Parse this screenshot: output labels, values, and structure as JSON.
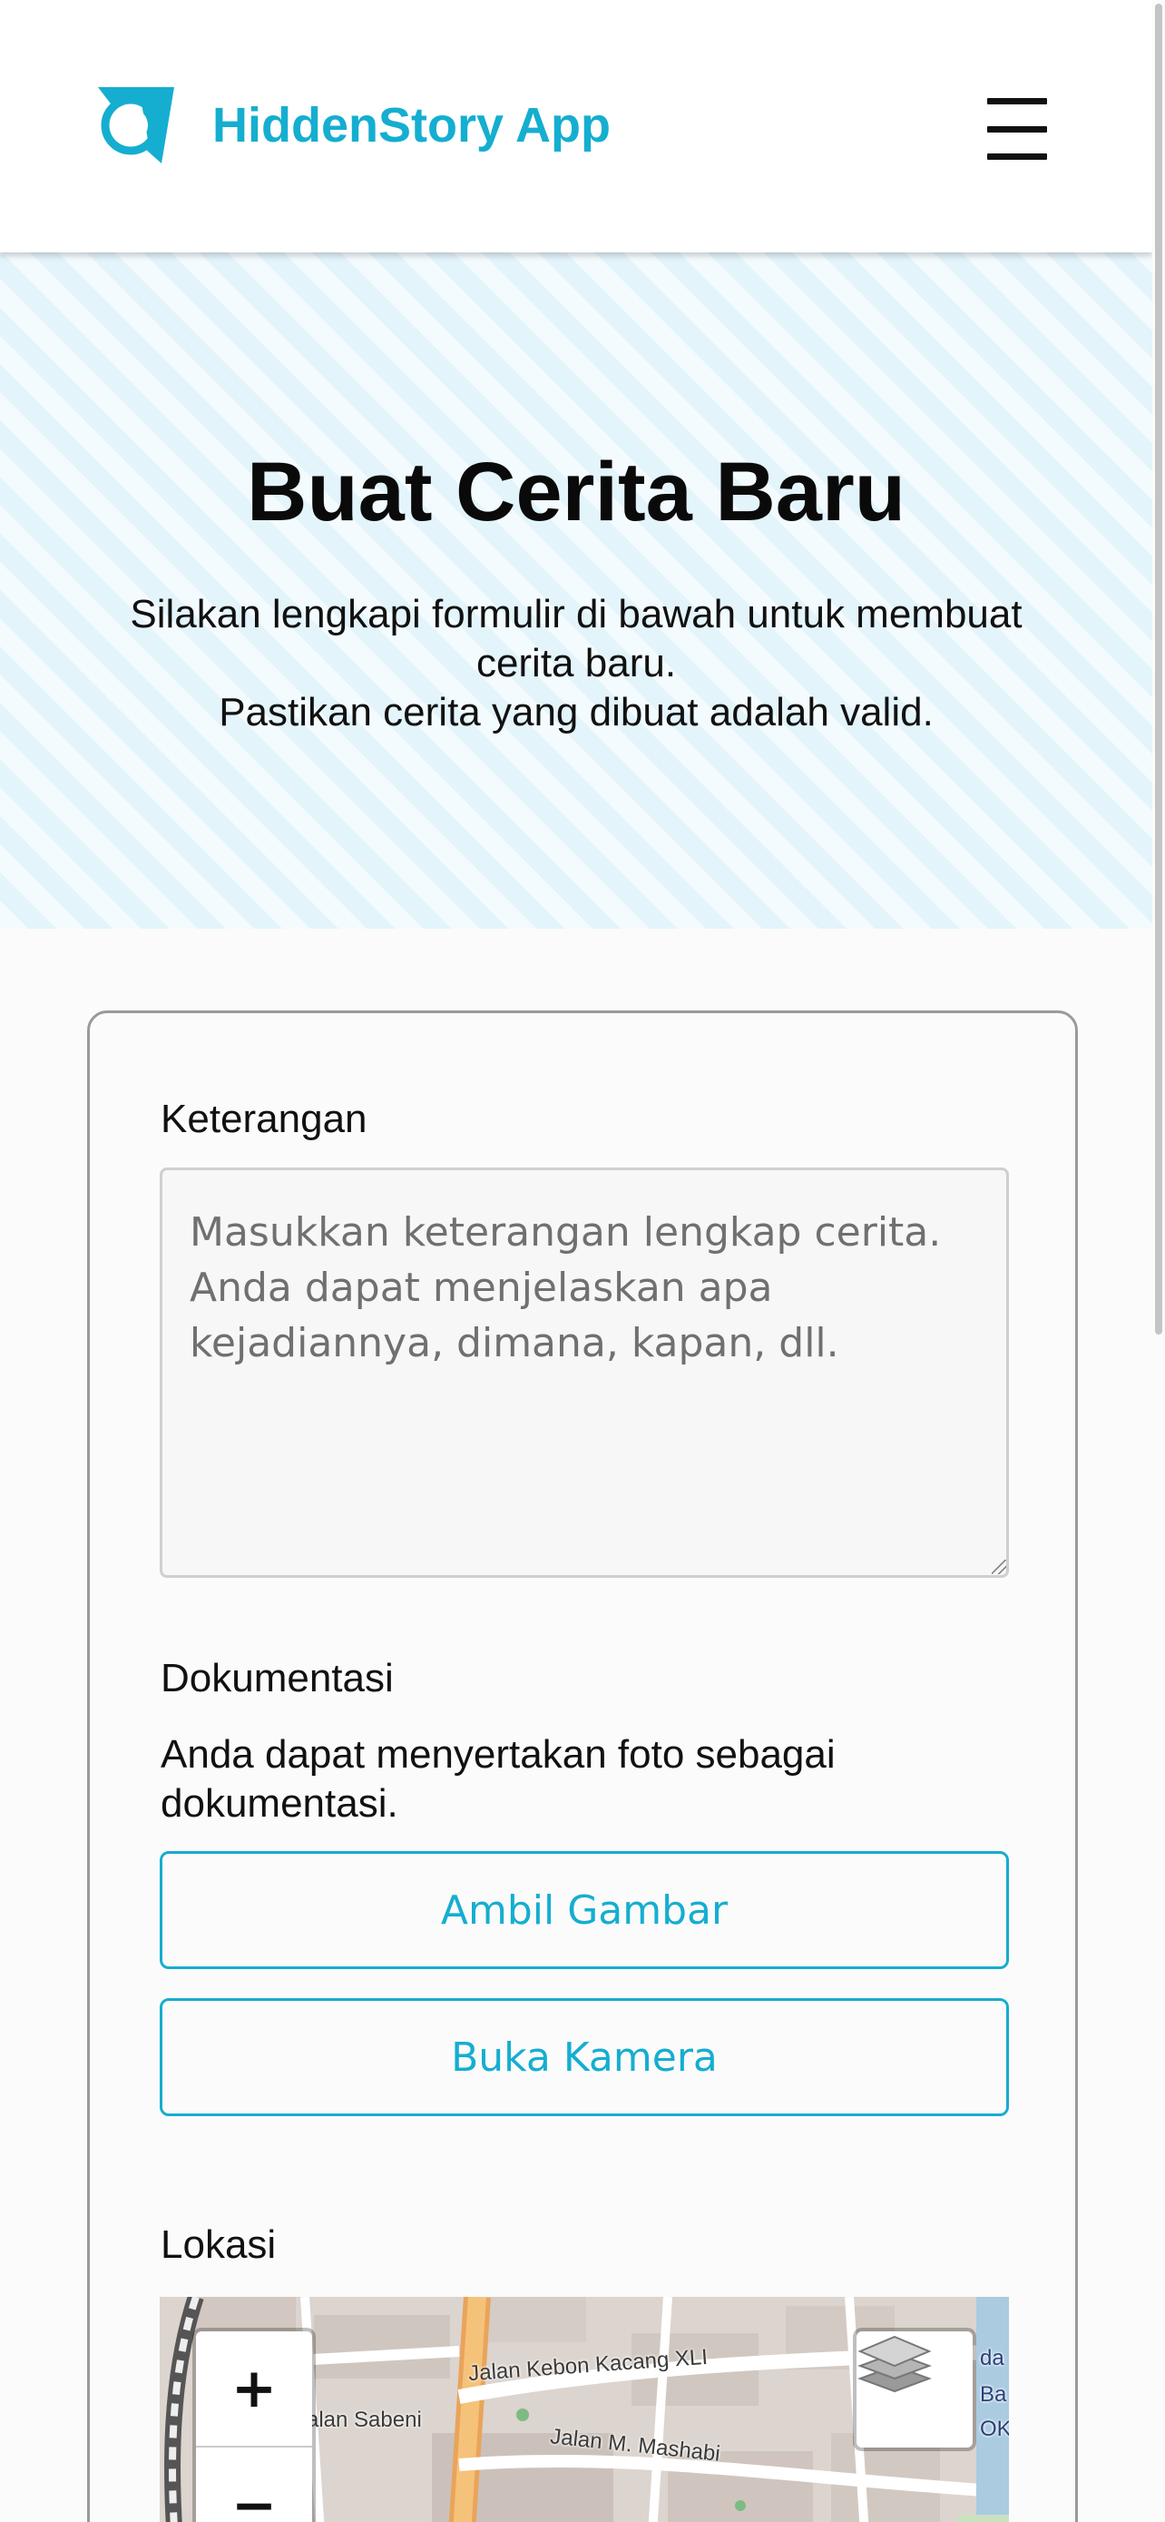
{
  "header": {
    "app_name": "HiddenStory App",
    "logo_icon": "story-logo-icon",
    "menu_icon": "hamburger-menu-icon",
    "brand_color": "#15aed0"
  },
  "hero": {
    "title": "Buat Cerita Baru",
    "subtitle_line1": "Silakan lengkapi formulir di bawah untuk membuat cerita baru.",
    "subtitle_line2": "Pastikan cerita yang dibuat adalah valid."
  },
  "form": {
    "description": {
      "label": "Keterangan",
      "placeholder": "Masukkan keterangan lengkap cerita. Anda dapat menjelaskan apa kejadiannya, dimana, kapan, dll.",
      "value": ""
    },
    "documentation": {
      "label": "Dokumentasi",
      "help": "Anda dapat menyertakan foto sebagai dokumentasi.",
      "pick_image_label": "Ambil Gambar",
      "open_camera_label": "Buka Kamera"
    },
    "location": {
      "label": "Lokasi",
      "zoom_in_label": "+",
      "zoom_out_label": "−",
      "layers_icon": "layers-icon",
      "streets": [
        "Jalan Kebon Kacang XLI",
        "Jalan Sabeni",
        "Jalan M. Mashabi"
      ],
      "edge_labels": [
        "da",
        "Ba",
        "OKI"
      ]
    }
  }
}
